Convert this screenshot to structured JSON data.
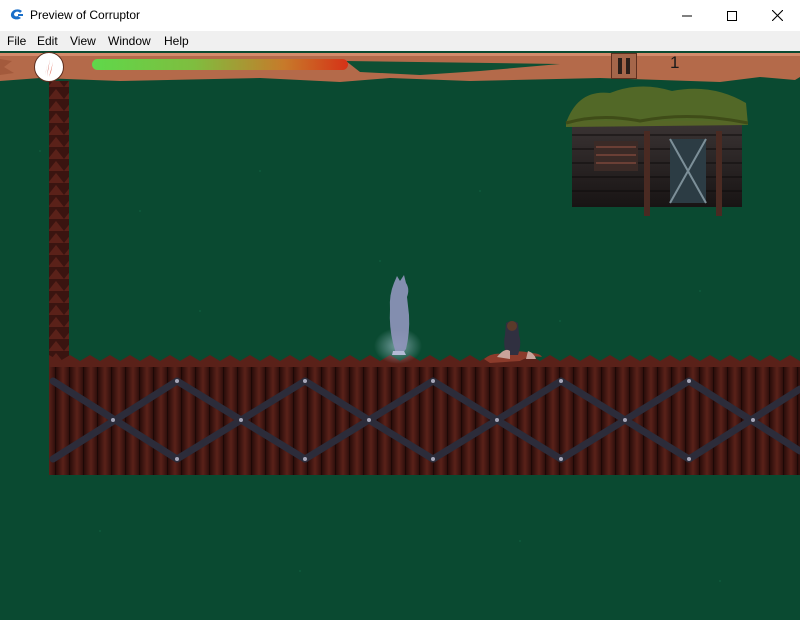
{
  "window": {
    "title": "Preview of Corruptor",
    "controls": {
      "minimize": "minimize-icon",
      "maximize": "maximize-icon",
      "close": "close-icon"
    }
  },
  "menu": [
    {
      "label": "File"
    },
    {
      "label": "Edit"
    },
    {
      "label": "View"
    },
    {
      "label": "Window"
    },
    {
      "label": "Help"
    }
  ],
  "hud": {
    "health_fraction": 0.55,
    "score": "1",
    "pause_icon": "pause-icon"
  },
  "colors": {
    "background": "#0a4a31",
    "hud_wood": "#b46a4a",
    "fence": "#4a1a14",
    "health_start": "#5fd84a",
    "health_end": "#d63217"
  }
}
